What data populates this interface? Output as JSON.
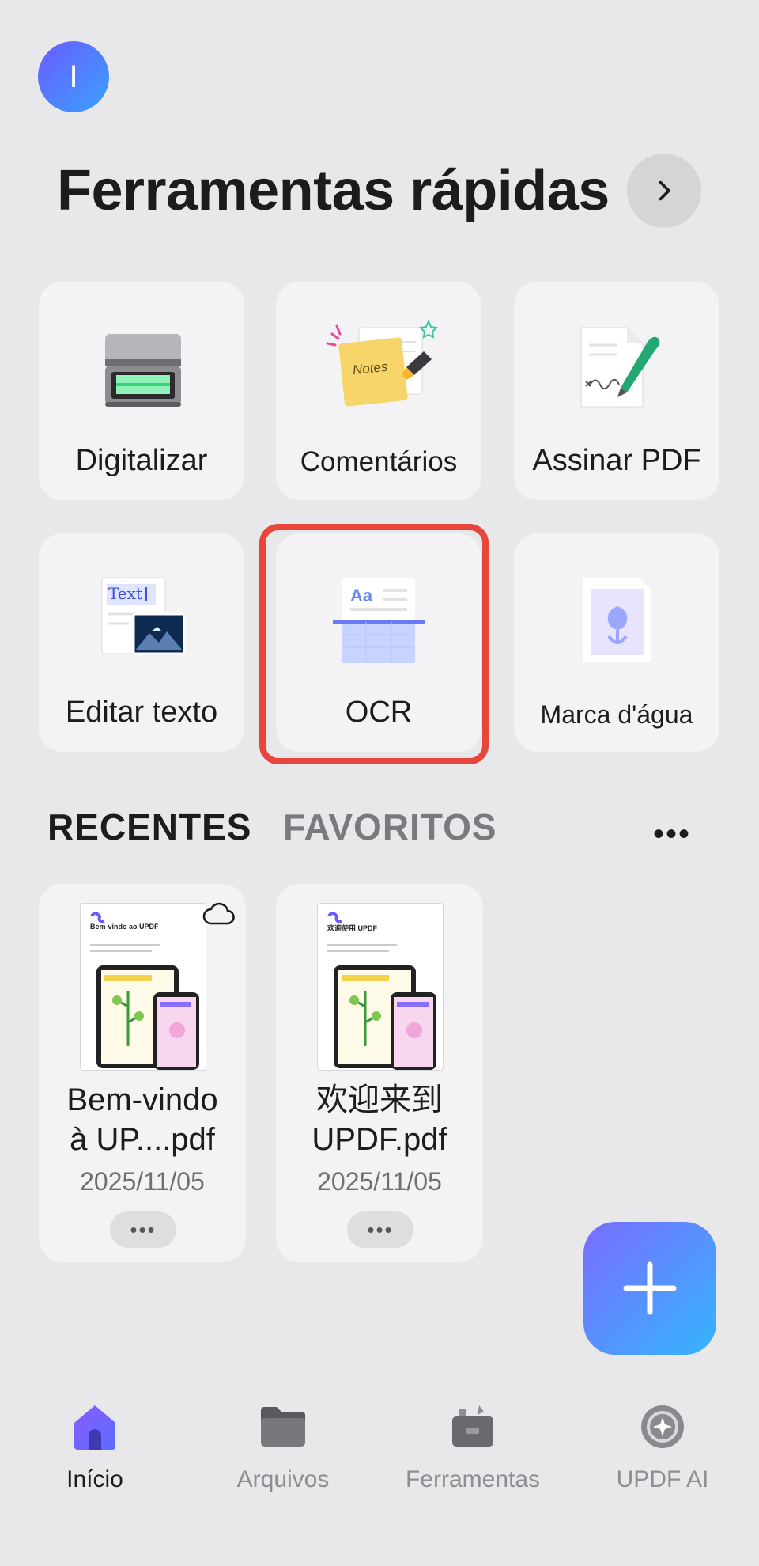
{
  "user": {
    "avatar_initial": "I"
  },
  "header": {
    "title": "Ferramentas rápidas"
  },
  "tools": [
    {
      "label": "Digitalizar"
    },
    {
      "label": "Comentários",
      "note_text": "Notes"
    },
    {
      "label": "Assinar PDF"
    },
    {
      "label": "Editar texto",
      "icon_text": "Text"
    },
    {
      "label": "OCR",
      "icon_text": "Aa"
    },
    {
      "label": "Marca d'água"
    }
  ],
  "tabs": {
    "recent": "RECENTES",
    "favorites": "FAVORITOS",
    "more": "•••"
  },
  "files": [
    {
      "name_line1": "Bem-vindo",
      "name_line2": "à UP....pdf",
      "date": "2025/11/05",
      "more": "•••",
      "thumb_title": "Bem-vindo ao UPDF"
    },
    {
      "name_line1": "欢迎来到",
      "name_line2": "UPDF.pdf",
      "date": "2025/11/05",
      "more": "•••",
      "thumb_title": "欢迎使用 UPDF"
    }
  ],
  "nav": [
    {
      "label": "Início",
      "active": true
    },
    {
      "label": "Arquivos"
    },
    {
      "label": "Ferramentas"
    },
    {
      "label": "UPDF AI"
    }
  ],
  "colors": {
    "accent": "#6a5cff",
    "highlight": "#e8453c",
    "background": "#e8e8ea"
  }
}
